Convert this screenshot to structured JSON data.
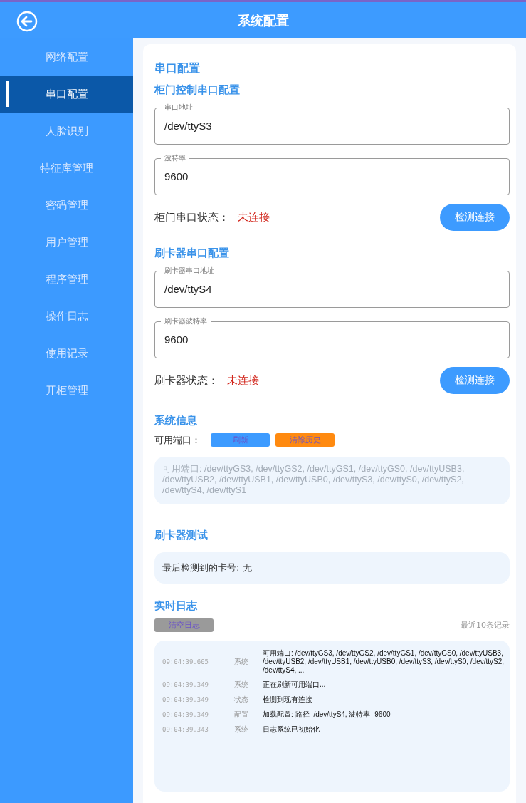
{
  "header": {
    "title": "系统配置"
  },
  "sidebar": {
    "items": [
      {
        "label": "网络配置",
        "selected": false
      },
      {
        "label": "串口配置",
        "selected": true
      },
      {
        "label": "人脸识别",
        "selected": false
      },
      {
        "label": "特征库管理",
        "selected": false
      },
      {
        "label": "密码管理",
        "selected": false
      },
      {
        "label": "用户管理",
        "selected": false
      },
      {
        "label": "程序管理",
        "selected": false
      },
      {
        "label": "操作日志",
        "selected": false
      },
      {
        "label": "使用记录",
        "selected": false
      },
      {
        "label": "开柜管理",
        "selected": false
      }
    ]
  },
  "content": {
    "title": "串口配置",
    "groups": [
      {
        "title": "柜门控制串口配置",
        "fields": [
          {
            "label": "串口地址",
            "value": "/dev/ttyS3"
          },
          {
            "label": "波特率",
            "value": "9600"
          }
        ],
        "status_label": "柜门串口状态：",
        "status": "未连接",
        "connected": false,
        "button": "检测连接"
      },
      {
        "title": "刷卡器串口配置",
        "fields": [
          {
            "label": "刷卡器串口地址",
            "value": "/dev/ttyS4"
          },
          {
            "label": "刷卡器波特率",
            "value": "9600"
          }
        ],
        "status_label": "刷卡器状态：",
        "status": "未连接",
        "connected": false,
        "button": "检测连接"
      }
    ],
    "system_info": {
      "title": "系统信息",
      "label": "可用端口：",
      "buttons": [
        {
          "label": "刷新",
          "kind": "primary"
        },
        {
          "label": "清除历史",
          "kind": "warning"
        }
      ],
      "ports_text": "可用端口: /dev/ttyGS3, /dev/ttyGS2, /dev/ttyGS1, /dev/ttyGS0, /dev/ttyUSB3, /dev/ttyUSB2, /dev/ttyUSB1, /dev/ttyUSB0, /dev/ttyS3, /dev/ttyS0, /dev/ttyS2, /dev/ttyS4, /dev/ttyS1"
    },
    "card_test": {
      "title": "刷卡器测试",
      "text": "最后检测到的卡号: 无"
    },
    "log": {
      "title": "实时日志",
      "clear_button": "清空日志",
      "note": "最近10条记录",
      "entries": [
        {
          "time": "09:04:39.605",
          "type": "系统",
          "message": "可用端口: /dev/ttyGS3, /dev/ttyGS2, /dev/ttyGS1, /dev/ttyGS0, /dev/ttyUSB3, /dev/ttyUSB2, /dev/ttyUSB1, /dev/ttyUSB0, /dev/ttyS3, /dev/ttyS0, /dev/ttyS2, /dev/ttyS4, ..."
        },
        {
          "time": "09:04:39.349",
          "type": "系统",
          "message": "正在刷新可用端口..."
        },
        {
          "time": "09:04:39.349",
          "type": "状态",
          "message": "检测到现有连接"
        },
        {
          "time": "09:04:39.349",
          "type": "配置",
          "message": "加载配置: 路径=/dev/ttyS4, 波特率=9600"
        },
        {
          "time": "09:04:39.343",
          "type": "系统",
          "message": "日志系统已初始化"
        }
      ]
    }
  }
}
